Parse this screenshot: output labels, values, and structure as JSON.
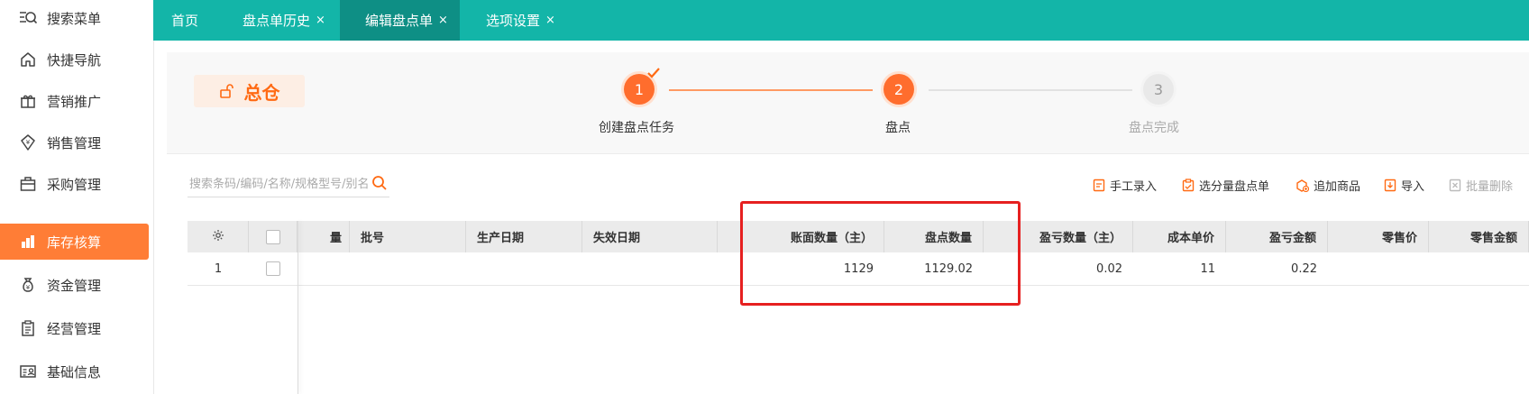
{
  "sidebar": {
    "items": [
      {
        "label": "搜索菜单",
        "icon": "search-menu-icon"
      },
      {
        "label": "快捷导航",
        "icon": "home-icon"
      },
      {
        "label": "营销推广",
        "icon": "gift-icon"
      },
      {
        "label": "销售管理",
        "icon": "sales-icon"
      },
      {
        "label": "采购管理",
        "icon": "briefcase-icon"
      },
      {
        "label": "库存核算",
        "icon": "inventory-icon",
        "active": true
      },
      {
        "label": "资金管理",
        "icon": "money-bag-icon"
      },
      {
        "label": "经营管理",
        "icon": "clipboard-icon"
      },
      {
        "label": "基础信息",
        "icon": "id-card-icon"
      }
    ]
  },
  "tabs": {
    "home": "首页",
    "history": "盘点单历史",
    "edit": "编辑盘点单",
    "options": "选项设置",
    "close": "×"
  },
  "header": {
    "warehouse": "总仓",
    "steps": [
      {
        "num": "1",
        "label": "创建盘点任务",
        "state": "done"
      },
      {
        "num": "2",
        "label": "盘点",
        "state": "current"
      },
      {
        "num": "3",
        "label": "盘点完成",
        "state": "pending"
      }
    ]
  },
  "search": {
    "placeholder": "搜索条码/编码/名称/规格型号/别名"
  },
  "toolbar": {
    "manual": "手工录入",
    "select_batch": "选分量盘点单",
    "add_goods": "追加商品",
    "import": "导入",
    "batch_delete": "批量删除"
  },
  "table": {
    "headers": {
      "partial": "量",
      "batch": "批号",
      "prod_date": "生产日期",
      "exp_date": "失效日期",
      "book_qty": "账面数量（主）",
      "count_qty": "盘点数量",
      "diff_qty": "盈亏数量（主）",
      "unit_cost": "成本单价",
      "diff_amount": "盈亏金额",
      "retail_price": "零售价",
      "retail_amount": "零售金额"
    },
    "rows": [
      {
        "index": "1",
        "book_qty": "1129",
        "count_qty": "1129.02",
        "diff_qty": "0.02",
        "unit_cost": "11",
        "diff_amount": "0.22"
      }
    ]
  },
  "colors": {
    "accent": "#ff6a13",
    "tabbar": "#13b5a8",
    "tab_active": "#0e8f85",
    "highlight": "#e62020"
  }
}
